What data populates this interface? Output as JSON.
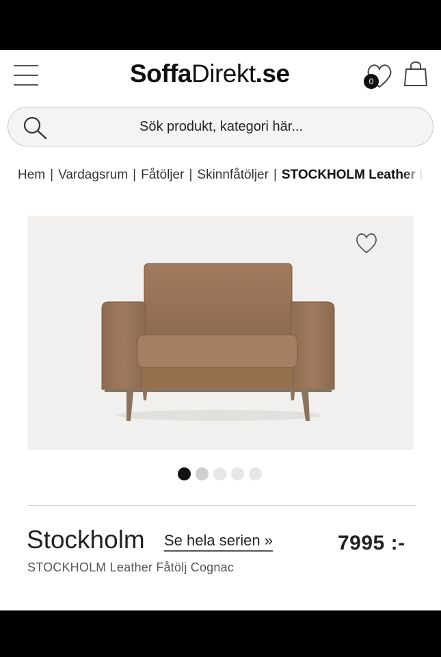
{
  "header": {
    "logo_part1": "Soffa",
    "logo_part2": "Direkt",
    "logo_part3": ".se",
    "wishlist_count": "0"
  },
  "search": {
    "placeholder": "Sök produkt, kategori här..."
  },
  "breadcrumb": {
    "items": [
      "Hem",
      "Vardagsrum",
      "Fåtöljer",
      "Skinnfåtöljer"
    ],
    "current": "STOCKHOLM Leather Fåtölj Cognac",
    "separator": "|"
  },
  "gallery": {
    "image_count": 5,
    "active_index": 0
  },
  "product": {
    "name": "Stockholm",
    "series_link": "Se hela serien »",
    "price": "7995 :-",
    "subtitle": "STOCKHOLM Leather Fåtölj Cognac"
  },
  "colors": {
    "leather": "#9a7256",
    "leather_dark": "#7d5a42",
    "legs": "#8a7460",
    "dot_active": "#111111",
    "dot_inactive": "#d9d9d9"
  }
}
